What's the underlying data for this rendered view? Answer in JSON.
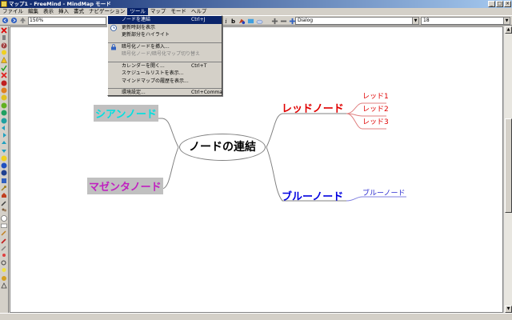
{
  "window": {
    "title": "マップ1 - FreeMind - MindMap モード"
  },
  "menubar": [
    "ファイル",
    "編集",
    "表示",
    "挿入",
    "書式",
    "ナビゲーション",
    "ツール",
    "マップ",
    "モード",
    "ヘルプ"
  ],
  "menubar_active_index": 6,
  "toolbar": {
    "zoom": "150%",
    "font": "Dialog",
    "font_size": "18"
  },
  "tools_menu": {
    "items": [
      {
        "label": "ノードを連結",
        "shortcut": "Ctrl+J",
        "selected": true
      },
      {
        "label": "更新時刻を表示",
        "icon": "clock-icon"
      },
      {
        "label": "更新部分をハイライト"
      },
      {
        "label": "暗号化ノードを挿入...",
        "icon": "lock-icon"
      },
      {
        "label": "暗号化ノード/暗号化マップ切り替え",
        "disabled": true
      },
      {
        "label": "カレンダーを開く...",
        "shortcut": "Ctrl+T"
      },
      {
        "label": "スケジュールリストを表示..."
      },
      {
        "label": "マインドマップの履歴を表示..."
      },
      {
        "label": "環境設定...",
        "shortcut": "Ctrl+Comma"
      }
    ]
  },
  "mindmap": {
    "central": "ノードの連結",
    "left": [
      "シアンノード",
      "マゼンタノード"
    ],
    "red": {
      "label": "レッドノード",
      "children": [
        "レッド1",
        "レッド2",
        "レッド3"
      ]
    },
    "blue": {
      "label": "ブルーノード",
      "children": [
        "ブルーノード"
      ]
    }
  },
  "colors": {
    "cyan": "#00e0e0",
    "magenta": "#c020c0",
    "red": "#e00000",
    "blue": "#0000e0",
    "selection": "#0a246a"
  }
}
